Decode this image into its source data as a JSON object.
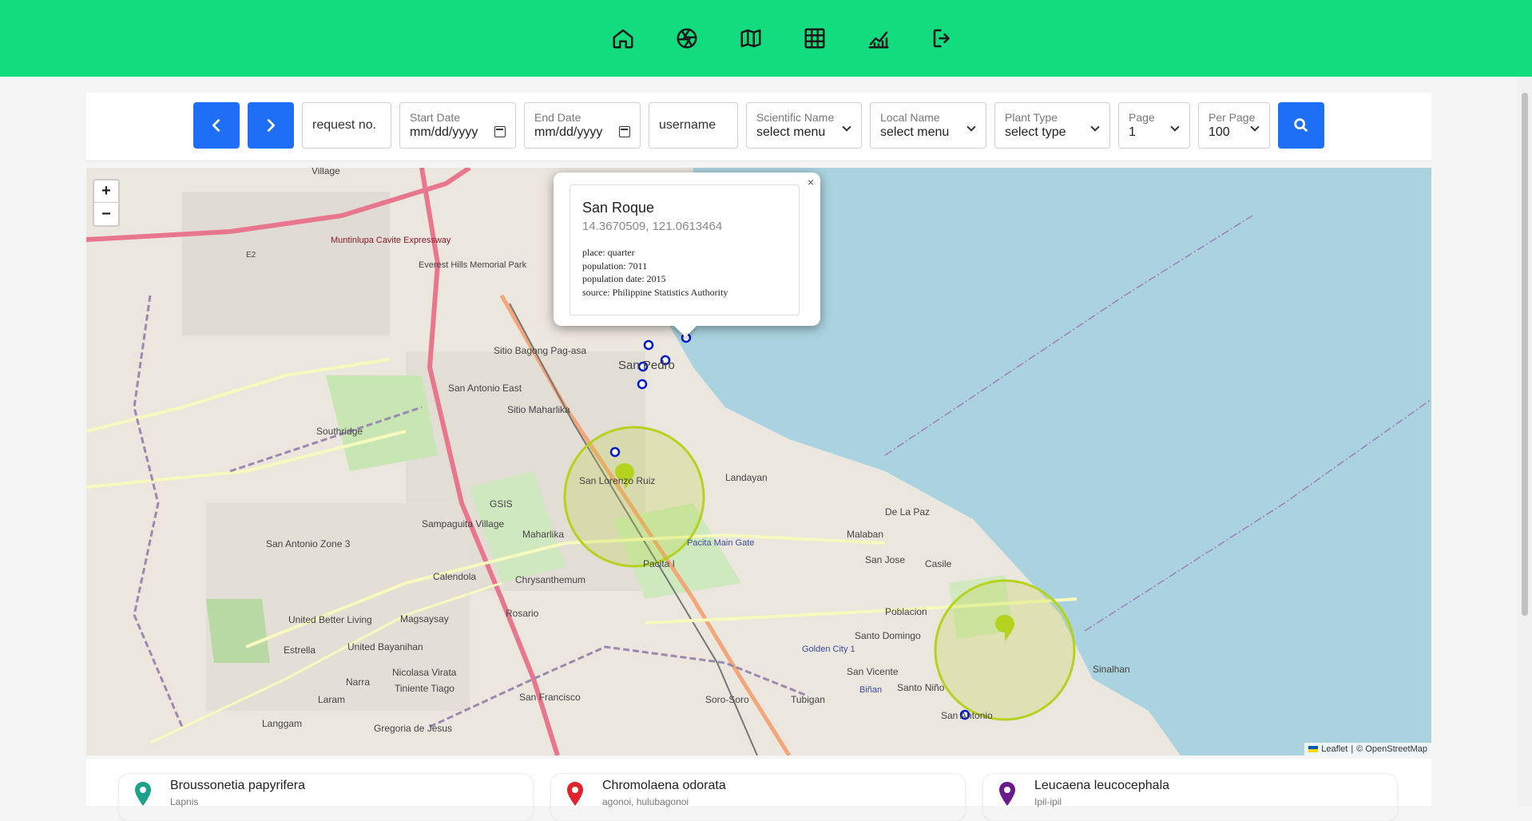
{
  "nav": {
    "icons": [
      "home-icon",
      "aperture-icon",
      "map-icon",
      "table-icon",
      "chart-icon",
      "logout-icon"
    ]
  },
  "filters": {
    "request_placeholder": "request no.",
    "start_date": {
      "label": "Start Date",
      "value": "mm/dd/yyyy"
    },
    "end_date": {
      "label": "End Date",
      "value": "mm/dd/yyyy"
    },
    "username_placeholder": "username",
    "scientific_name": {
      "label": "Scientific Name",
      "value": "select menu"
    },
    "local_name": {
      "label": "Local Name",
      "value": "select menu"
    },
    "plant_type": {
      "label": "Plant Type",
      "value": "select type"
    },
    "page": {
      "label": "Page",
      "value": "1"
    },
    "per_page": {
      "label": "Per Page",
      "value": "100"
    }
  },
  "map": {
    "zoom_in": "+",
    "zoom_out": "−",
    "attribution_leaflet": "Leaflet",
    "attribution_sep": "|",
    "attribution_osm": "© OpenStreetMap",
    "labels": {
      "san_pedro": "San Pedro",
      "landayan": "Landayan",
      "de_la_paz": "De La Paz",
      "malaban": "Malaban",
      "san_jose": "San Jose",
      "casile": "Casile",
      "poblacion": "Poblacion",
      "santo_domingo": "Santo Domingo",
      "sinalhan": "Sinalhan",
      "san_vicente": "San Vicente",
      "santo_nino": "Santo Niño",
      "san_antonio": "San Antonio",
      "tubigan": "Tubigan",
      "soro_soro": "Soro-Soro",
      "san_francisco": "San Francisco",
      "langgam": "Langgam",
      "laram": "Laram",
      "narra": "Narra",
      "estrella": "Estrella",
      "magsaysay": "Magsaysay",
      "rosario": "Rosario",
      "calendola": "Calendola",
      "chrysanthemum": "Chrysanthemum",
      "maharlika": "Maharlika",
      "pacita": "Pacita I",
      "gsis": "GSIS",
      "sampaguita": "Sampaguita Village",
      "united_bayanihan": "United Bayanihan",
      "nicolasa": "Nicolasa Virata",
      "tiniente": "Tiniente Tiago",
      "gregoria": "Gregoria de Jesus",
      "southridge": "Southridge",
      "sitio_bagong": "Sitio Bagong Pag-asa",
      "sitio_maharlika": "Sitio Maharlika",
      "san_antonio_east": "San Antonio East",
      "san_lorenzo": "San Lorenzo Ruiz",
      "village": "Village",
      "expressway": "Muntinlupa Cavite Expressway",
      "everest": "Everest Hills Memorial Park",
      "united_better": "United Better Living",
      "san_antonio_zone": "San Antonio Zone 3",
      "pacita_gate": "Pacita Main Gate",
      "golden_city": "Golden City 1",
      "binan": "Biñan",
      "e2": "E2"
    }
  },
  "popup": {
    "name": "San Roque",
    "coords": "14.3670509, 121.0613464",
    "place": "place: quarter",
    "population": "population: 7011",
    "population_date": "population date: 2015",
    "source": "source: Philippine Statistics Authority",
    "close": "×"
  },
  "plants": [
    {
      "scientific": "Broussonetia papyrifera",
      "local": "Lapnis",
      "color": "#1aa389"
    },
    {
      "scientific": "Chromolaena odorata",
      "local": "agonoi, hulubagonoi",
      "color": "#e2232e"
    },
    {
      "scientific": "Leucaena leucocephala",
      "local": "Ipil-ipil",
      "color": "#6a1a8a"
    }
  ],
  "colors": {
    "topbar": "#12dc7e",
    "accent": "#1e6ff5",
    "water": "#aad3df",
    "circle": "#b4d21e",
    "marker": "#0019c8"
  }
}
